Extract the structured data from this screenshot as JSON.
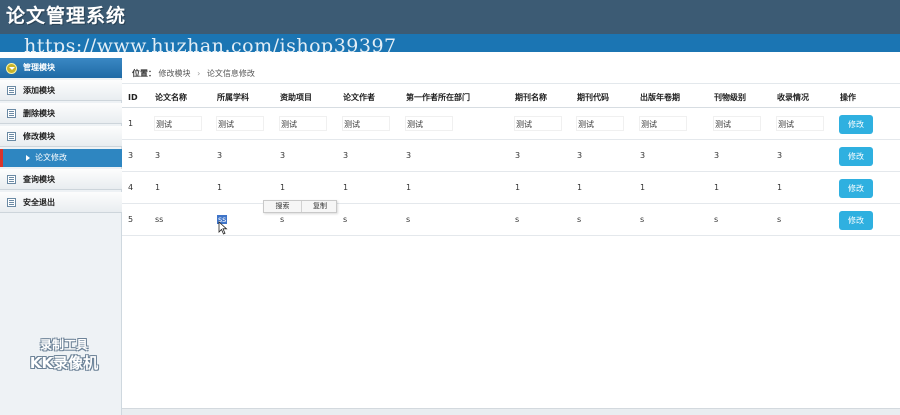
{
  "header": {
    "app_title": "论文管理系统",
    "watermark_url": "https://www.huzhan.com/ishop39397"
  },
  "sidebar": {
    "section_title": "管理模块",
    "items": [
      {
        "label": "添加模块"
      },
      {
        "label": "删除模块"
      },
      {
        "label": "修改模块"
      },
      {
        "label": "查询模块"
      },
      {
        "label": "安全退出"
      }
    ],
    "active_sub_item": "论文修改",
    "watermark_line1": "录制工具",
    "watermark_line2": "KK录像机"
  },
  "breadcrumb": {
    "label": "位置：",
    "crumb1": "修改模块",
    "sep": "›",
    "crumb2": "论文信息修改"
  },
  "table": {
    "columns": [
      "ID",
      "论文名称",
      "所属学科",
      "资助项目",
      "论文作者",
      "第一作者所在部门",
      "期刊名称",
      "期刊代码",
      "出版年卷期",
      "刊物级别",
      "收录情况",
      "操作"
    ],
    "rows": [
      {
        "id": "1",
        "cells": [
          "测试",
          "测试",
          "测试",
          "测试",
          "测试",
          "测试",
          "测试",
          "测试",
          "测试",
          "测试"
        ],
        "action": "修改"
      },
      {
        "id": "3",
        "cells": [
          "3",
          "3",
          "3",
          "3",
          "3",
          "3",
          "3",
          "3",
          "3",
          "3"
        ],
        "action": "修改"
      },
      {
        "id": "4",
        "cells": [
          "1",
          "1",
          "1",
          "1",
          "1",
          "1",
          "1",
          "1",
          "1",
          "1"
        ],
        "action": "修改"
      },
      {
        "id": "5",
        "cells": [
          "ss",
          "ss",
          "s",
          "s",
          "s",
          "s",
          "s",
          "s",
          "s",
          "s"
        ],
        "action": "修改"
      }
    ]
  },
  "context_popup": {
    "search_label": "搜索",
    "copy_label": "复制"
  },
  "colors": {
    "header_bg": "#3c5b74",
    "subbar_bg": "#1b75b3",
    "accent": "#2e86c1",
    "button": "#2fb0e0",
    "selection": "#3f74c8"
  }
}
